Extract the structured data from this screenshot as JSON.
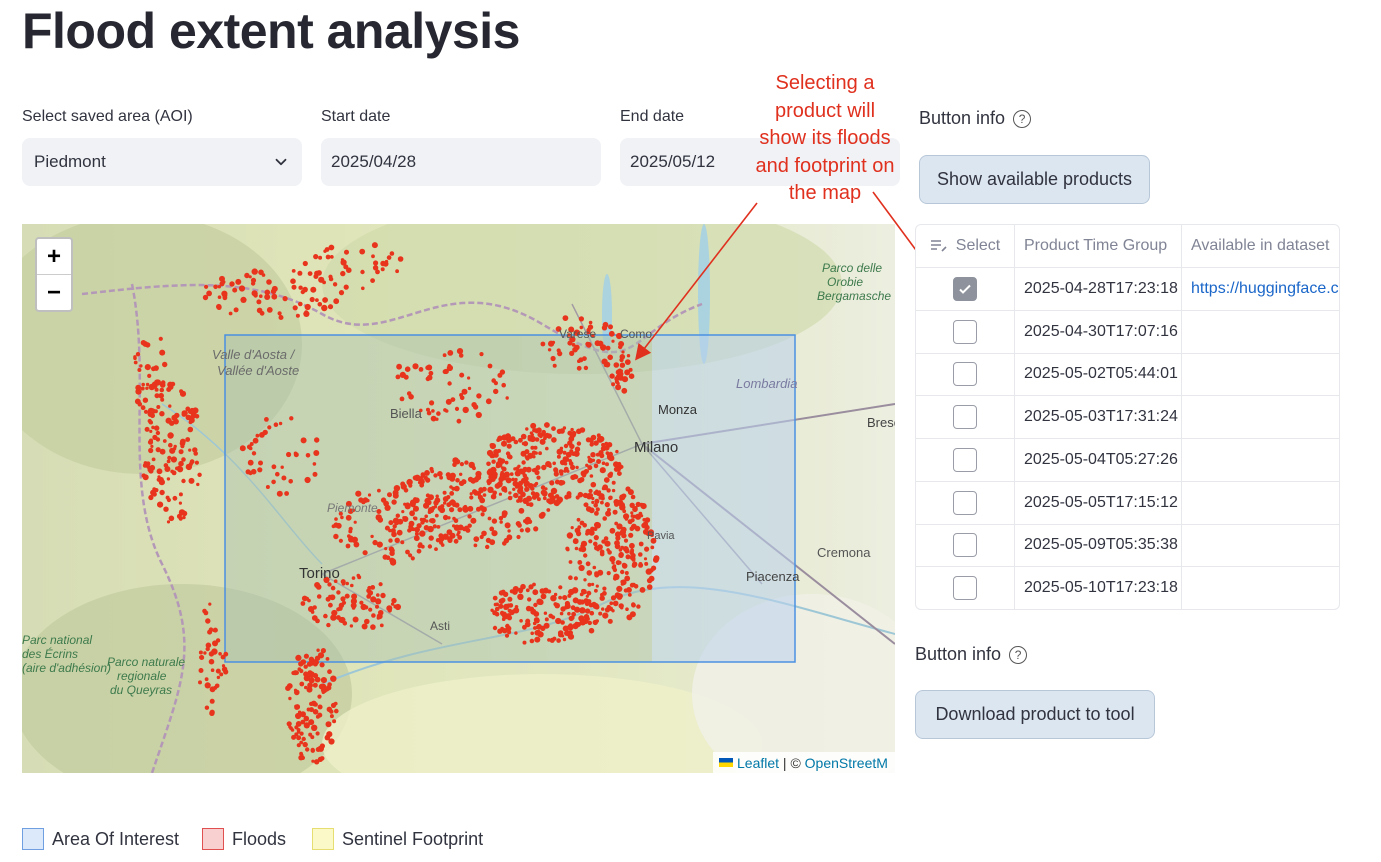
{
  "page": {
    "title": "Flood extent analysis"
  },
  "form": {
    "aoi": {
      "label": "Select saved area (AOI)",
      "value": "Piedmont"
    },
    "start": {
      "label": "Start date",
      "value": "2025/04/28"
    },
    "end": {
      "label": "End date",
      "value": "2025/05/12"
    }
  },
  "annotation": {
    "lines": [
      "Selecting a",
      "product will",
      "show its floods",
      "and footprint on",
      "the map"
    ],
    "color": "#e0301e"
  },
  "map": {
    "zoom_in": "+",
    "zoom_out": "−",
    "labels": [
      "Valle d'Aosta /",
      "Vallée d'Aoste",
      "Biella",
      "Varese",
      "Como",
      "Monza",
      "Milano",
      "Torino",
      "Asti",
      "Pavia",
      "Piacenza",
      "Cremona",
      "Bresc",
      "Lombardia",
      "Parco delle",
      "Orobie",
      "Bergamasche",
      "Parc national",
      "des Écrins",
      "(aire d'adhésion)",
      "Parco naturale",
      "regionale",
      "du Queyras",
      "Piemonte"
    ],
    "attribution": {
      "leaflet": "Leaflet",
      "sep": " | © ",
      "osm": "OpenStreetM"
    }
  },
  "panel": {
    "info1": "Button info",
    "show_products": "Show available products",
    "info2": "Button info",
    "download": "Download product to tool"
  },
  "table": {
    "headers": [
      "Select",
      "Product Time Group",
      "Available in dataset"
    ],
    "rows": [
      {
        "checked": true,
        "time": "2025-04-28T17:23:18",
        "dataset": "https://huggingface.c"
      },
      {
        "checked": false,
        "time": "2025-04-30T17:07:16",
        "dataset": ""
      },
      {
        "checked": false,
        "time": "2025-05-02T05:44:01",
        "dataset": ""
      },
      {
        "checked": false,
        "time": "2025-05-03T17:31:24",
        "dataset": ""
      },
      {
        "checked": false,
        "time": "2025-05-04T05:27:26",
        "dataset": ""
      },
      {
        "checked": false,
        "time": "2025-05-05T17:15:12",
        "dataset": ""
      },
      {
        "checked": false,
        "time": "2025-05-09T05:35:38",
        "dataset": ""
      },
      {
        "checked": false,
        "time": "2025-05-10T17:23:18",
        "dataset": ""
      }
    ]
  },
  "legend": [
    {
      "label": "Area Of Interest",
      "fill": "#dce9fb",
      "stroke": "#6f9fe0"
    },
    {
      "label": "Floods",
      "fill": "#f8d0d0",
      "stroke": "#e05050"
    },
    {
      "label": "Sentinel Footprint",
      "fill": "#fcf9c8",
      "stroke": "#e6de70"
    }
  ],
  "colors": {
    "flood": "#e8341c",
    "aoi": "#4a90e2"
  }
}
